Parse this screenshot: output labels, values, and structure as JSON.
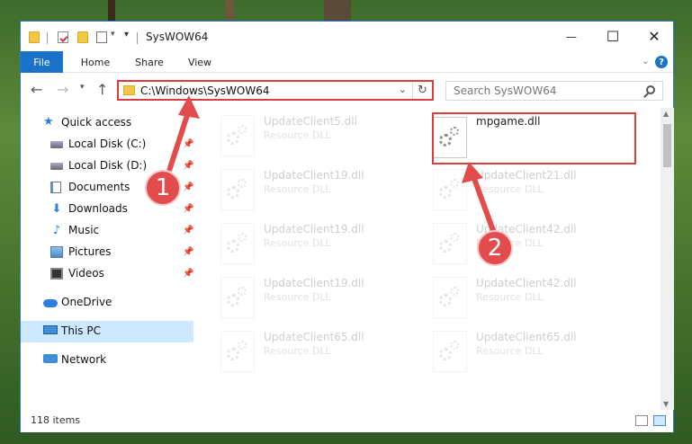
{
  "window": {
    "title": "SysWOW64",
    "minimize": "—",
    "maximize": "☐",
    "close": "✕"
  },
  "ribbon": {
    "tabs": [
      "File",
      "Home",
      "Share",
      "View"
    ],
    "help": "?"
  },
  "address": {
    "path": "C:\\Windows\\SysWOW64",
    "search_placeholder": "Search SysWOW64"
  },
  "nav": {
    "quick_access": "Quick access",
    "items": [
      {
        "label": "Local Disk (C:)",
        "icon": "local-disk-icon",
        "pinned": true
      },
      {
        "label": "Local Disk (D:)",
        "icon": "local-disk-icon",
        "pinned": true
      },
      {
        "label": "Documents",
        "icon": "documents-icon",
        "pinned": true
      },
      {
        "label": "Downloads",
        "icon": "downloads-icon",
        "pinned": true
      },
      {
        "label": "Music",
        "icon": "music-icon",
        "pinned": true
      },
      {
        "label": "Pictures",
        "icon": "pictures-icon",
        "pinned": true
      },
      {
        "label": "Videos",
        "icon": "videos-icon",
        "pinned": true
      }
    ],
    "onedrive": "OneDrive",
    "this_pc": "This PC",
    "network": "Network"
  },
  "files": {
    "left_column": [
      {
        "name": "UpdateClient5.dll",
        "type": "Resource DLL"
      },
      {
        "name": "UpdateClient19.dll",
        "type": "Resource DLL"
      },
      {
        "name": "UpdateClient19.dll",
        "type": "Resource DLL"
      },
      {
        "name": "UpdateClient19.dll",
        "type": "Resource DLL"
      },
      {
        "name": "UpdateClient65.dll",
        "type": "Resource DLL"
      }
    ],
    "right_column": [
      {
        "name": "mpgame.dll",
        "type": ""
      },
      {
        "name": "UpdateClient21.dll",
        "type": "Resource DLL"
      },
      {
        "name": "UpdateClient42.dll",
        "type": "Resource DLL"
      },
      {
        "name": "UpdateClient42.dll",
        "type": "Resource DLL"
      },
      {
        "name": "UpdateClient65.dll",
        "type": "Resource DLL"
      }
    ]
  },
  "status": {
    "item_count": "118 items"
  },
  "annotations": {
    "step1": "1",
    "step2": "2",
    "color": "#dd3c3c"
  }
}
